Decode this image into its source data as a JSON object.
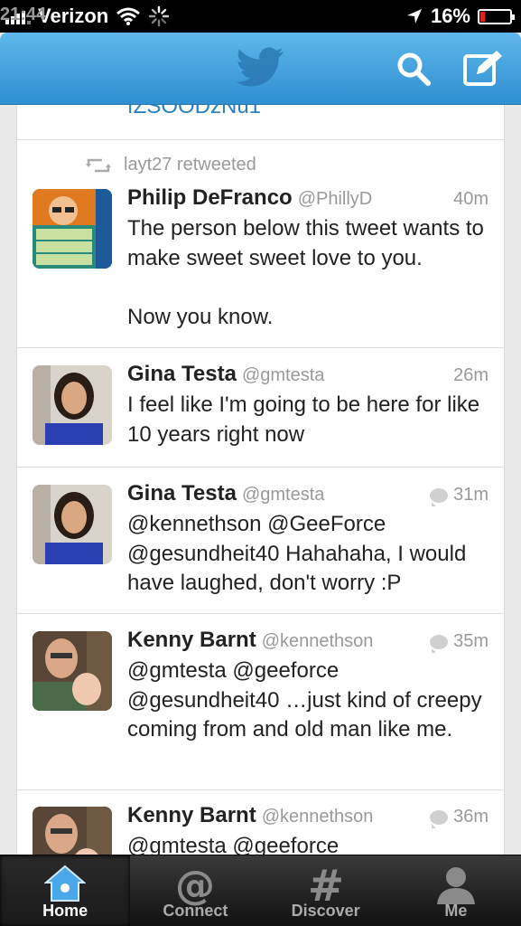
{
  "status": {
    "carrier": "Verizon",
    "time": "21:44",
    "battery": "16%",
    "battery_level": 0.16
  },
  "nav": {
    "logo_icon": "twitter-bird-icon",
    "search_icon": "search-icon",
    "compose_icon": "compose-icon"
  },
  "timeline": {
    "clipped_text": "fZSOODzNu1",
    "retweet_label": "layt27 retweeted",
    "tweets": [
      {
        "name": "Philip DeFranco",
        "handle": "@PhillyD",
        "time": "40m",
        "text": "The person below this tweet wants to make sweet sweet love to you.\n\nNow you know."
      },
      {
        "name": "Gina Testa",
        "handle": "@gmtesta",
        "time": "26m",
        "text": "I feel like I'm going to be here for like 10 years right now"
      },
      {
        "name": "Gina Testa",
        "handle": "@gmtesta",
        "time": "31m",
        "text": "@kennethson @GeeForce @gesundheit40 Hahahaha, I would have laughed, don't worry :P"
      },
      {
        "name": "Kenny Barnt",
        "handle": "@kennethson",
        "time": "35m",
        "text": "@gmtesta @geeforce @gesundheit40 …just kind of creepy coming from and old man like me."
      },
      {
        "name": "Kenny Barnt",
        "handle": "@kennethson",
        "time": "36m",
        "text": "@gmtesta @geeforce"
      }
    ]
  },
  "tabs": [
    {
      "label": "Home",
      "icon": "home-icon"
    },
    {
      "label": "Connect",
      "icon": "at-sign-icon"
    },
    {
      "label": "Discover",
      "icon": "hashtag-icon"
    },
    {
      "label": "Me",
      "icon": "person-icon"
    }
  ],
  "colors": {
    "nav_blue": "#3a9ad9",
    "link_blue": "#2a7fc0",
    "battery_red": "#e0201c"
  }
}
